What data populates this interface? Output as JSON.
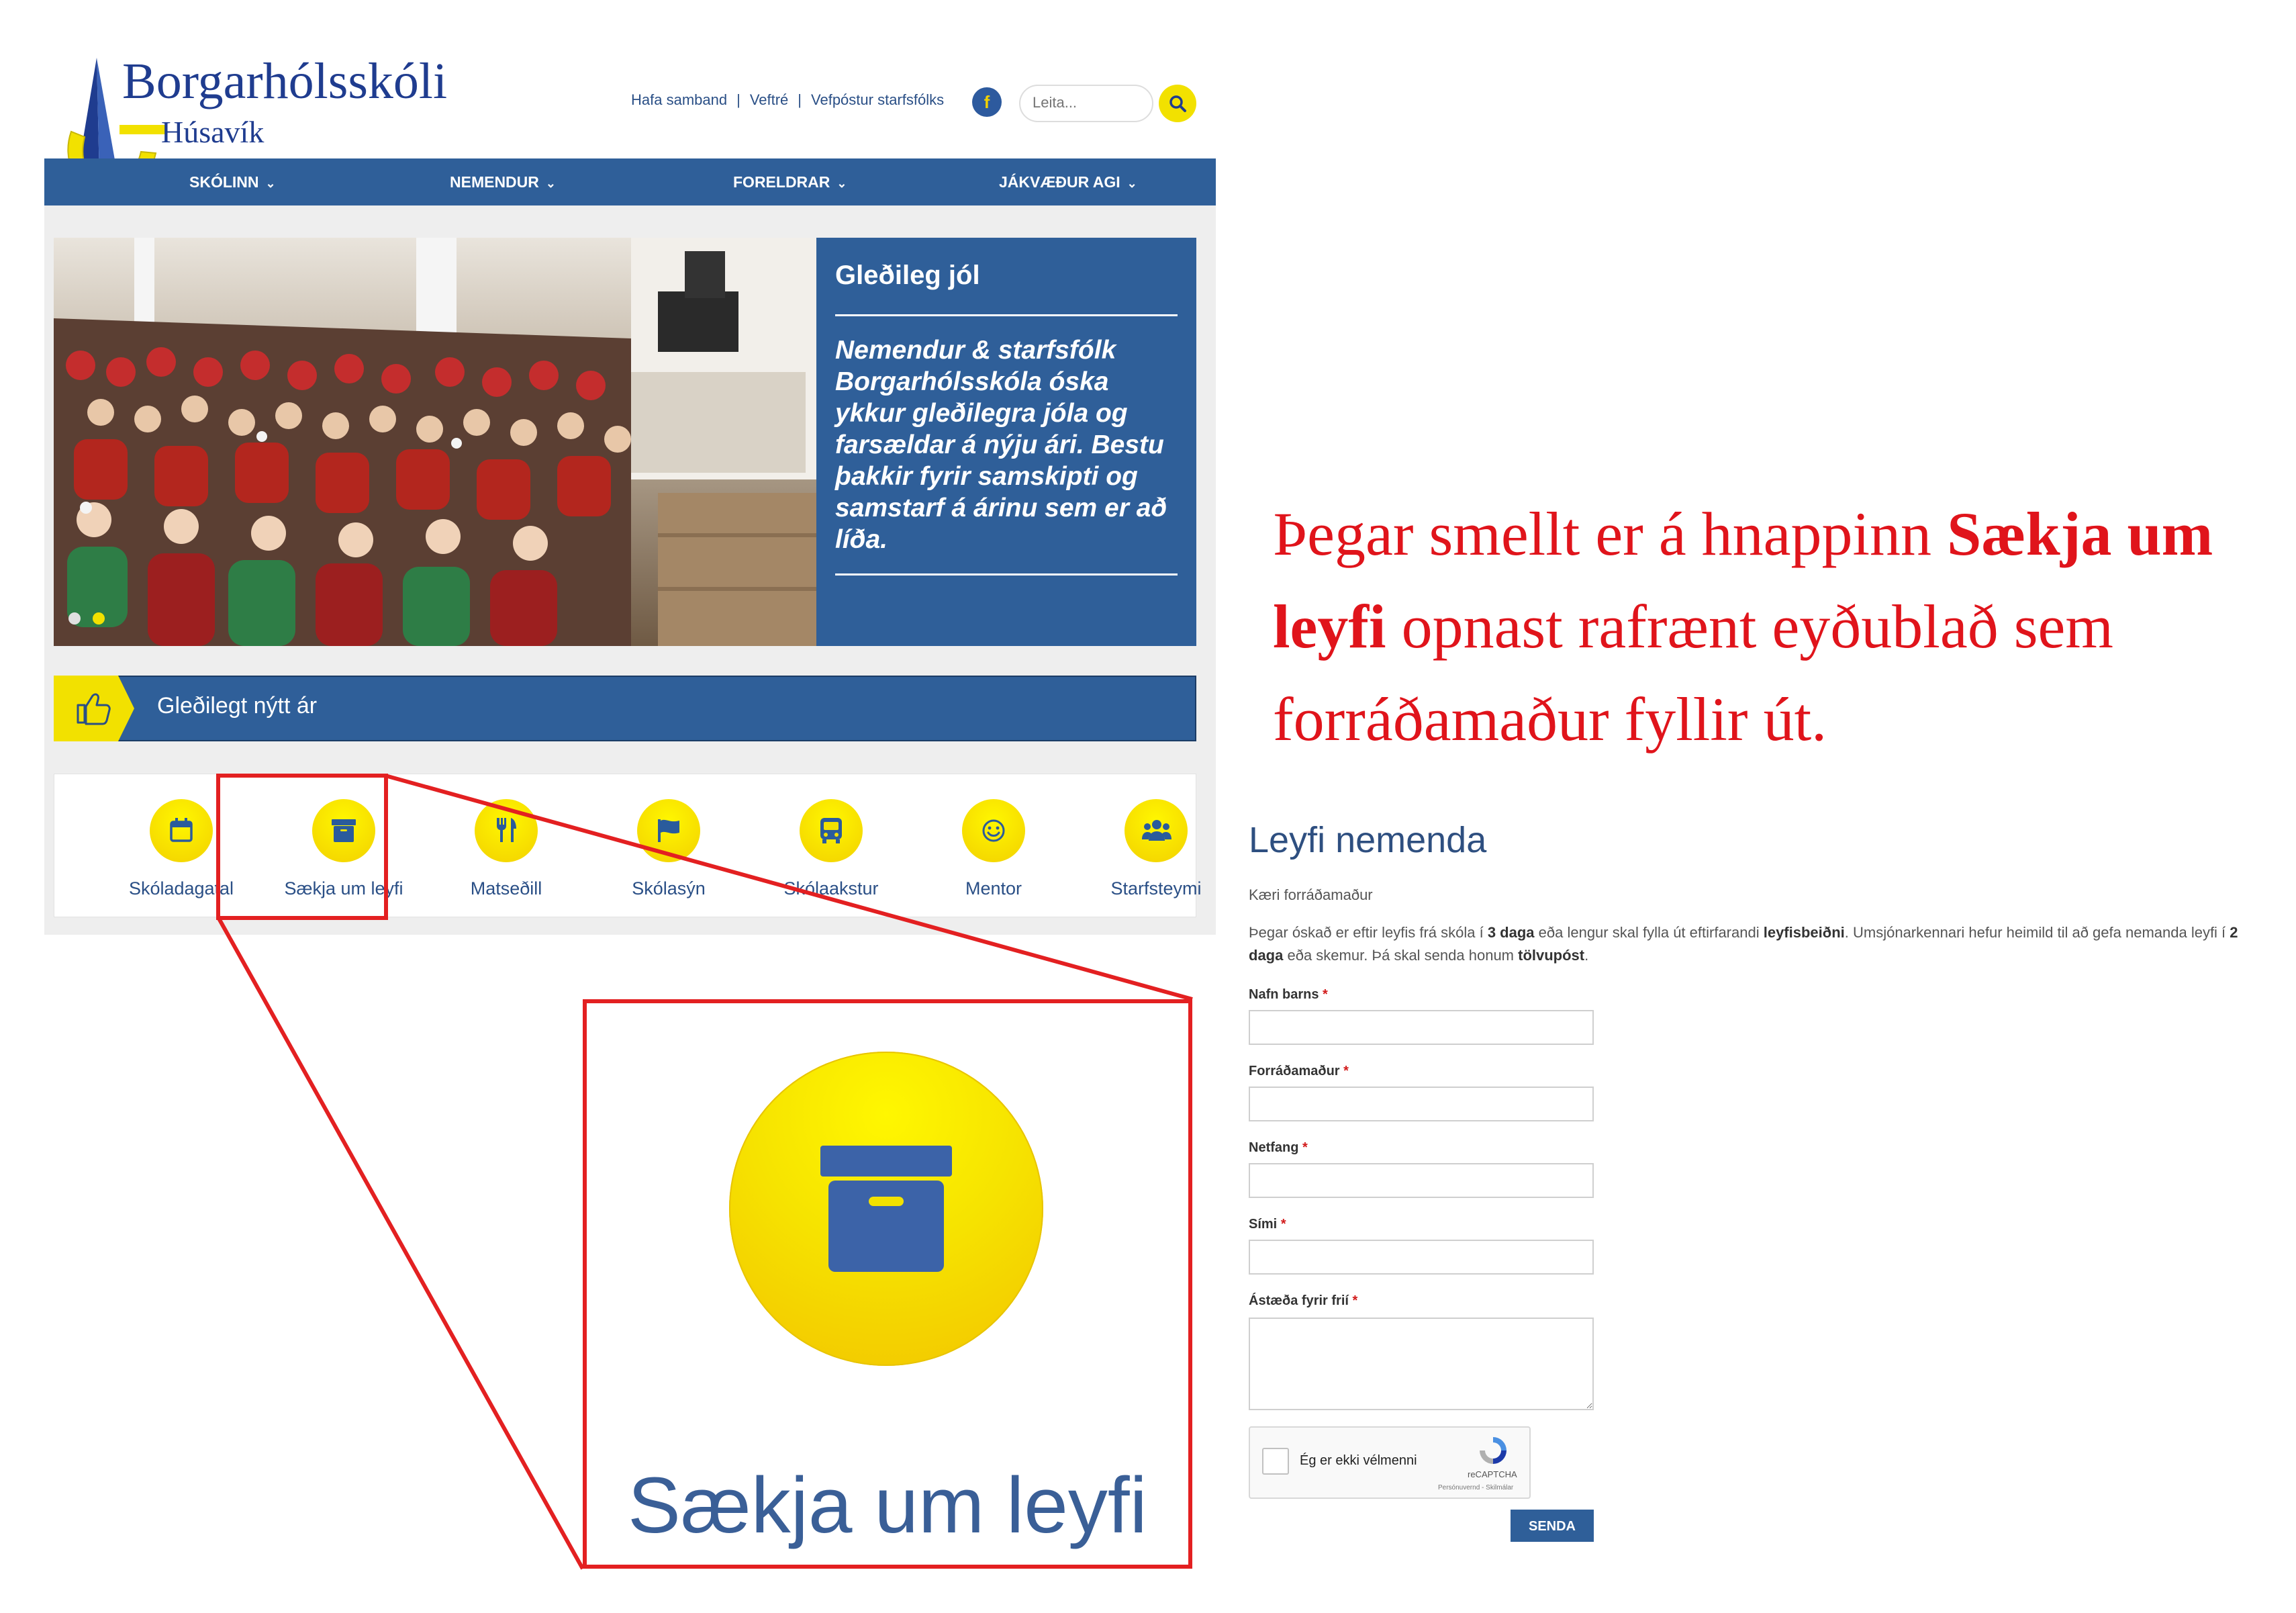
{
  "site": {
    "logo_title": "Borgarhólsskóli",
    "logo_subtitle": "Húsavík",
    "top_links": [
      "Hafa samband",
      "Veftré",
      "Vefpóstur starfsfólks"
    ],
    "link_separator": "|",
    "facebook_glyph": "f",
    "search_placeholder": "Leita...",
    "nav": [
      "SKÓLINN",
      "NEMENDUR",
      "FORELDRAR",
      "JÁKVÆÐUR AGI"
    ],
    "hero": {
      "title": "Gleðileg jól",
      "body": "Nemendur & starfsfólk Borgarhólsskóla óska ykkur gleðilegra jóla og farsældar á nýju ári. Bestu þakkir fyrir samskipti og samstarf á árinu sem er að líða."
    },
    "ticker": "Gleðilegt nýtt ár",
    "tiles": [
      {
        "label": "Skóladagatal",
        "icon": "calendar-icon"
      },
      {
        "label": "Sækja um leyfi",
        "icon": "archive-box-icon"
      },
      {
        "label": "Matseðill",
        "icon": "utensils-icon"
      },
      {
        "label": "Skólasýn",
        "icon": "flag-icon"
      },
      {
        "label": "Skólaakstur",
        "icon": "bus-icon"
      },
      {
        "label": "Mentor",
        "icon": "smiley-icon"
      },
      {
        "label": "Starfsteymi",
        "icon": "users-icon"
      }
    ]
  },
  "zoom": {
    "label": "Sækja um leyfi",
    "icon": "archive-box-icon"
  },
  "caption": {
    "part1": "Þegar smellt er á hnappinn ",
    "bold": "Sækja um leyfi",
    "part2": " opnast rafrænt eyðublað sem forráðamaður fyllir út."
  },
  "form": {
    "title": "Leyfi nemenda",
    "greeting": "Kæri forráðamaður",
    "intro_1": "Þegar óskað er eftir leyfis frá skóla í ",
    "intro_b1": "3 daga",
    "intro_2": " eða lengur skal fylla út eftirfarandi ",
    "intro_b2": "leyfisbeiðni",
    "intro_3": ". Umsjónarkennari hefur heimild til að gefa nemanda leyfi í ",
    "intro_b3": "2 daga",
    "intro_4": " eða skemur. Þá skal senda honum ",
    "intro_b4": "tölvupóst",
    "intro_5": ".",
    "required_mark": "*",
    "fields": [
      {
        "label": "Nafn barns",
        "value": ""
      },
      {
        "label": "Forráðamaður",
        "value": ""
      },
      {
        "label": "Netfang",
        "value": ""
      },
      {
        "label": "Sími",
        "value": ""
      },
      {
        "label": "Ástæða fyrir frií",
        "value": ""
      }
    ],
    "captcha_label": "Ég er ekki vélmenni",
    "captcha_brand": "reCAPTCHA",
    "captcha_sub": "Persónuvernd - Skilmálar",
    "submit": "SENDA"
  },
  "colors": {
    "brand_blue": "#2f5f99",
    "accent_yellow": "#f2e100",
    "highlight_red": "#e32021",
    "caption_red": "#e0141b"
  }
}
